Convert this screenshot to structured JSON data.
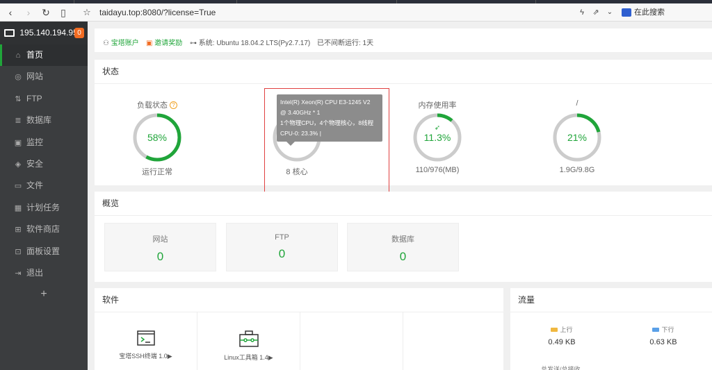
{
  "browser": {
    "url": "taidayu.top:8080/?license=True",
    "search_placeholder": "在此搜索"
  },
  "sidebar": {
    "server_ip": "195.140.194.95",
    "badge": "0",
    "items": [
      {
        "label": "首页",
        "icon": "home-icon",
        "glyph": "⌂"
      },
      {
        "label": "网站",
        "icon": "globe-icon",
        "glyph": "◎"
      },
      {
        "label": "FTP",
        "icon": "ftp-icon",
        "glyph": "⇅"
      },
      {
        "label": "数据库",
        "icon": "database-icon",
        "glyph": "≣"
      },
      {
        "label": "监控",
        "icon": "monitor-icon",
        "glyph": "▣"
      },
      {
        "label": "安全",
        "icon": "shield-icon",
        "glyph": "◈"
      },
      {
        "label": "文件",
        "icon": "folder-icon",
        "glyph": "▭"
      },
      {
        "label": "计划任务",
        "icon": "calendar-icon",
        "glyph": "▦"
      },
      {
        "label": "软件商店",
        "icon": "apps-icon",
        "glyph": "⊞"
      },
      {
        "label": "面板设置",
        "icon": "settings-icon",
        "glyph": "⊡"
      },
      {
        "label": "退出",
        "icon": "logout-icon",
        "glyph": "⇥"
      }
    ],
    "add": "+"
  },
  "topinfo": {
    "account": "宝塔账户",
    "invite": "邀请奖励",
    "system": "系统:  Ubuntu 18.04.2 LTS(Py2.7.17)",
    "uptime": "已不间断运行: 1天"
  },
  "status": {
    "title": "状态",
    "gauges": [
      {
        "title": "负载状态",
        "value": "58%",
        "fraction": 0.58,
        "sub": "运行正常"
      },
      {
        "title": "",
        "value": "7.4%",
        "fraction": 0.074,
        "sub": "8 核心"
      },
      {
        "title": "内存使用率",
        "value": "11.3%",
        "fraction": 0.113,
        "sub": "110/976(MB)"
      },
      {
        "title": "/",
        "value": "21%",
        "fraction": 0.21,
        "sub": "1.9G/9.8G"
      }
    ],
    "tooltip": {
      "line1": "Intel(R) Xeon(R) CPU E3-1245 V2",
      "line2": "@ 3.40GHz * 1",
      "line3": "1个物理CPU，4个物理核心，8线程",
      "line4": "CPU-0: 23.3% |"
    }
  },
  "overview": {
    "title": "概览",
    "boxes": [
      {
        "label": "网站",
        "value": "0"
      },
      {
        "label": "FTP",
        "value": "0"
      },
      {
        "label": "数据库",
        "value": "0"
      }
    ]
  },
  "software": {
    "title": "软件",
    "items": [
      {
        "label": "宝塔SSH终端 1.0▶",
        "icon": "terminal-icon"
      },
      {
        "label": "Linux工具箱 1.4▶",
        "icon": "toolbox-icon"
      }
    ]
  },
  "traffic": {
    "title": "流量",
    "up_label": "上行",
    "up_value": "0.49 KB",
    "down_label": "下行",
    "down_value": "0.63 KB",
    "more": "总发送/总接收"
  },
  "colors": {
    "accent": "#20a53a",
    "up": "#f0b840",
    "down": "#5aa0e8",
    "track": "#cccccc"
  }
}
